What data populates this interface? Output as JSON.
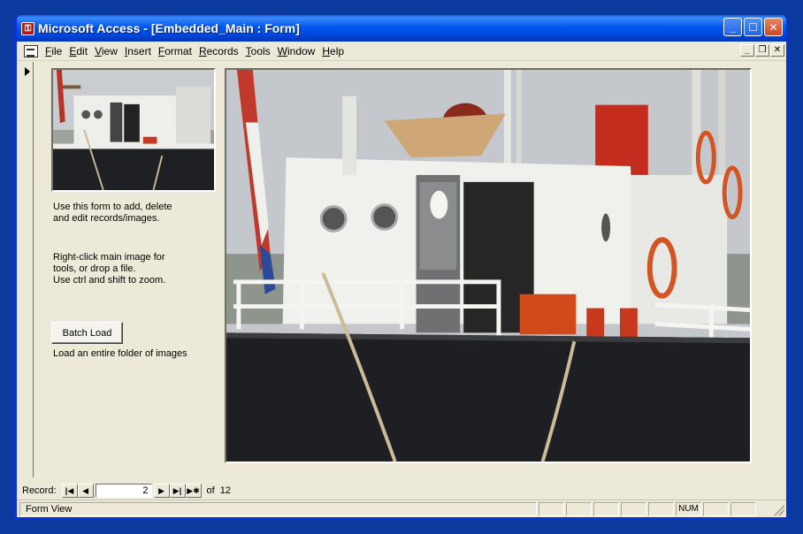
{
  "window": {
    "title": "Microsoft Access - [Embedded_Main : Form]",
    "app_icon": "access-key-icon"
  },
  "menu": {
    "items": [
      {
        "label": "File",
        "key": "F",
        "rest": "ile"
      },
      {
        "label": "Edit",
        "key": "E",
        "rest": "dit"
      },
      {
        "label": "View",
        "key": "V",
        "rest": "iew"
      },
      {
        "label": "Insert",
        "key": "I",
        "rest": "nsert"
      },
      {
        "label": "Format",
        "key": "F",
        "rest": "ormat"
      },
      {
        "label": "Records",
        "key": "R",
        "rest": "ecords"
      },
      {
        "label": "Tools",
        "key": "T",
        "rest": "ools"
      },
      {
        "label": "Window",
        "key": "W",
        "rest": "indow"
      },
      {
        "label": "Help",
        "key": "H",
        "rest": "elp"
      }
    ]
  },
  "form": {
    "instructions_1": "Use this form to add, delete\nand edit records/images.",
    "instructions_2": "Right-click main image for\ntools, or drop a file.\nUse ctrl and shift to zoom.",
    "batch_button": "Batch Load",
    "batch_desc": "Load an entire folder of images"
  },
  "navigation": {
    "record_label": "Record:",
    "current_record": "2",
    "of_label": "of",
    "total_records": "12"
  },
  "status": {
    "view": "Form View",
    "num_indicator": "NUM"
  },
  "colors": {
    "desktop": "#0a3a9e",
    "titlebar": "#0058ee",
    "form_bg": "#ece9d8"
  }
}
